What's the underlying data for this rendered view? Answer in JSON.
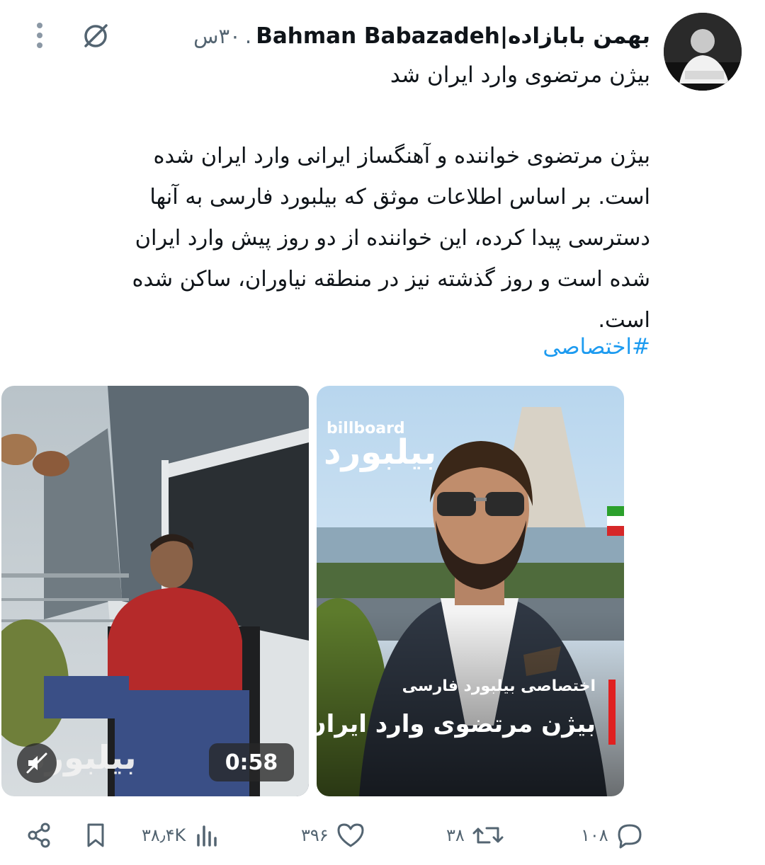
{
  "header": {
    "author_name": "بهمن بابازاده|Bahman Babazadeh",
    "separator": ".",
    "time_ago": "۳۰س",
    "grok_icon": "slashed-circle-icon",
    "more_icon": "vertical-dots-icon"
  },
  "post": {
    "title": "بیژن مرتضوی وارد ایران شد",
    "body_lines": [
      "بیژن مرتضوی خواننده و آهنگساز ایرانی وارد ایران شده",
      "است. بر اساس اطلاعات موثق که بیلبورد فارسی به آنها",
      "دسترسی پیدا کرده، این خواننده از دو روز پیش وارد ایران",
      "شده است و روز گذشته نیز در منطقه نیاوران، ساکن شده",
      "است."
    ],
    "hashtag": "#اختصاصی"
  },
  "media": {
    "video": {
      "duration": "0:58",
      "brand_mark": "بیلبورد",
      "mute_icon": "muted-speaker-icon"
    },
    "image": {
      "logo_en": "billboard",
      "logo_fa": "بیلبورد",
      "caption_tag": "اختصاصی بیلبورد فارسی",
      "caption_title": "بیژن مرتضوی وارد ایران شد"
    }
  },
  "actions": {
    "replies": "۱۰۸",
    "reposts": "۳۸",
    "likes": "۳۹۶",
    "views": "۳۸٫۴K"
  },
  "colors": {
    "text": "#0f1419",
    "muted": "#536471",
    "link": "#1d9bf0",
    "caption_accent": "#e02020"
  }
}
